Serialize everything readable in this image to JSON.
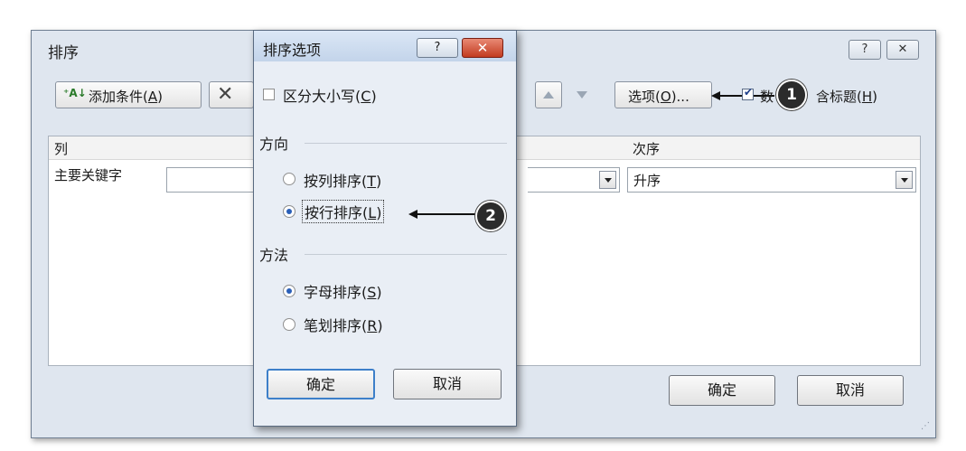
{
  "main": {
    "title": "排序",
    "help_glyph": "?",
    "close_glyph": "✕",
    "add_level_label": "添加条件",
    "add_level_key": "A",
    "delete_partial": "✕",
    "options_label": "选项",
    "options_key": "O",
    "header_checkbox_label_a": "数",
    "header_checkbox_label_b": "含标题",
    "header_checkbox_key": "H",
    "header_checked": true,
    "columns": {
      "col": "列",
      "order": "次序"
    },
    "row": {
      "key_label": "主要关键字",
      "order_value": "升序"
    },
    "ok_label": "确定",
    "cancel_label": "取消"
  },
  "dialog": {
    "title": "排序选项",
    "help_glyph": "?",
    "close_glyph": "✕",
    "case_label": "区分大小写",
    "case_key": "C",
    "case_checked": false,
    "orientation_title": "方向",
    "by_column_label": "按列排序",
    "by_column_key": "T",
    "by_row_label": "按行排序",
    "by_row_key": "L",
    "orientation_selected": "by_row",
    "method_title": "方法",
    "letter_label": "字母排序",
    "letter_key": "S",
    "stroke_label": "笔划排序",
    "stroke_key": "R",
    "method_selected": "letter",
    "ok_label": "确定",
    "cancel_label": "取消"
  },
  "callouts": [
    "1",
    "2"
  ]
}
